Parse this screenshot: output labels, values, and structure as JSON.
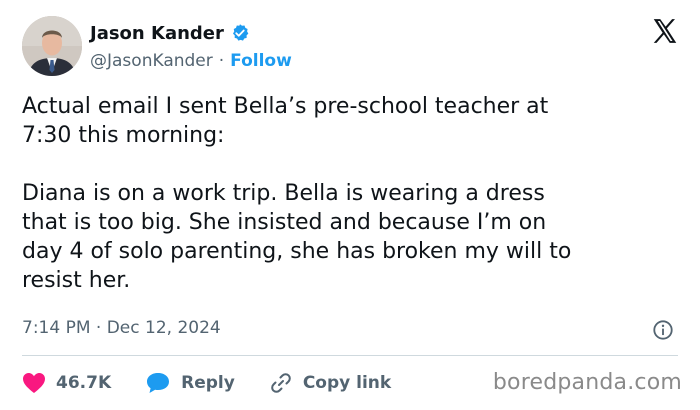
{
  "author": {
    "display_name": "Jason Kander",
    "handle": "@JasonKander",
    "separator": "·",
    "follow_label": "Follow"
  },
  "tweet": {
    "text": "Actual email I sent Bella’s pre-school teacher at\n7:30 this morning:\n\nDiana is on a work trip. Bella is wearing a dress\nthat is too big. She insisted and because I’m on\nday 4 of solo parenting, she has broken my will to\nresist her.",
    "timestamp": "7:14 PM · Dec 12, 2024"
  },
  "actions": {
    "likes": "46.7K",
    "reply_label": "Reply",
    "copy_link_label": "Copy link"
  },
  "watermark": "boredpanda.com",
  "colors": {
    "like": "#f91880",
    "reply": "#1d9bf0",
    "verified": "#1d9bf0",
    "secondary_text": "#536471"
  },
  "icons": [
    "verified-badge-icon",
    "x-logo-icon",
    "info-icon",
    "heart-icon",
    "reply-bubble-icon",
    "link-icon"
  ]
}
